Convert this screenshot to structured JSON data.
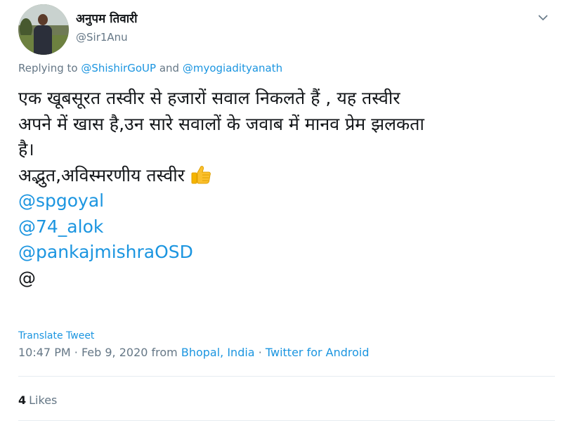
{
  "user": {
    "name": "अनुपम तिवारी",
    "handle": "@Sir1Anu"
  },
  "icons": {
    "menu": "chevron-down-icon",
    "emoji": "thumbs-up-icon"
  },
  "reply": {
    "prefix": "Replying to",
    "mention1": "@ShishirGoUP",
    "and": "and",
    "mention2": "@myogiadityanath"
  },
  "tweet": {
    "line1": "एक खूबसूरत तस्वीर से हजारों सवाल  निकलते हैं , यह तस्वीर",
    "line2": "अपने में खास है,उन सारे सवालों के जवाब में मानव प्रेम झलकता",
    "line3": "है।",
    "line4": "अद्भुत,अविस्मरणीय तस्वीर",
    "mentions": [
      "@spgoyal",
      "@74_alok",
      "@pankajmishraOSD"
    ],
    "trailing": "@"
  },
  "translate_label": "Translate Tweet",
  "meta": {
    "time": "10:47 PM",
    "date": "Feb 9, 2020",
    "from": "from",
    "location": "Bhopal, India",
    "source": "Twitter for Android",
    "sep": "·"
  },
  "stats": {
    "likes_count": "4",
    "likes_label": "Likes"
  },
  "colors": {
    "link": "#1b95e0",
    "secondary": "#657786",
    "text": "#14171a"
  }
}
